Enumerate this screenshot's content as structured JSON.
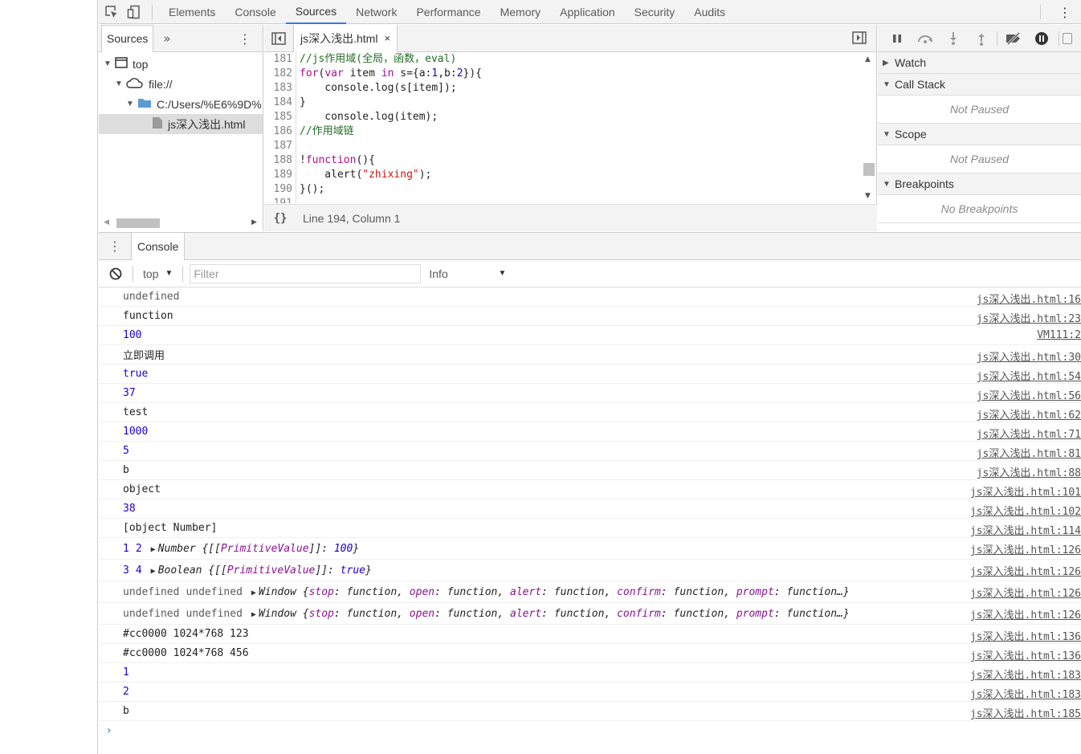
{
  "main_tabs": [
    "Elements",
    "Console",
    "Sources",
    "Network",
    "Performance",
    "Memory",
    "Application",
    "Security",
    "Audits"
  ],
  "active_main_tab": "Sources",
  "navigator": {
    "tab_label": "Sources",
    "more": "»",
    "tree": [
      {
        "label": "top",
        "level": 0,
        "icon": "frame-icon"
      },
      {
        "label": "file://",
        "level": 1,
        "icon": "cloud-icon"
      },
      {
        "label": "C:/Users/%E6%9D%",
        "level": 2,
        "icon": "folder-icon"
      },
      {
        "label": "js深入浅出.html",
        "level": 3,
        "icon": "file-icon",
        "selected": true
      }
    ]
  },
  "editor": {
    "file_tab": "js深入浅出.html",
    "close": "×",
    "status": "Line 194, Column 1",
    "pretty_print": "{}",
    "lines": [
      {
        "n": "181",
        "html": "<span class='cm'>//js作用域(全局，函数，eval)</span>"
      },
      {
        "n": "182",
        "html": "<span class='kw'>for</span>(<span class='kw'>var</span> item <span class='kw'>in</span> s={a:<span class='num'>1</span>,b:<span class='num'>2</span>}){"
      },
      {
        "n": "183",
        "html": "    console.log(s[item]);"
      },
      {
        "n": "184",
        "html": "}"
      },
      {
        "n": "185",
        "html": "    console.log(item);"
      },
      {
        "n": "186",
        "html": "<span class='cm'>//作用域链</span>"
      },
      {
        "n": "187",
        "html": ""
      },
      {
        "n": "188",
        "html": "!<span class='kw'>function</span>(){"
      },
      {
        "n": "189",
        "html": "    alert(<span class='str'>\"zhixing\"</span>);"
      },
      {
        "n": "190",
        "html": "}();"
      },
      {
        "n": "191",
        "html": ""
      }
    ]
  },
  "debugger": {
    "panes": [
      {
        "title": "Watch",
        "expanded": false
      },
      {
        "title": "Call Stack",
        "expanded": true,
        "body": "Not Paused"
      },
      {
        "title": "Scope",
        "expanded": true,
        "body": "Not Paused"
      },
      {
        "title": "Breakpoints",
        "expanded": true,
        "body": "No Breakpoints"
      }
    ]
  },
  "drawer": {
    "tab": "Console",
    "context": "top",
    "filter_placeholder": "Filter",
    "level": "Info",
    "messages": [
      {
        "text": "undefined",
        "cls": "gray",
        "src": "js深入浅出.html:16"
      },
      {
        "text": "function",
        "cls": "",
        "src": "js深入浅出.html:23"
      },
      {
        "text": "100",
        "cls": "num",
        "src": "VM111:2"
      },
      {
        "text": "立即调用",
        "cls": "",
        "src": "js深入浅出.html:30"
      },
      {
        "text": "true",
        "cls": "bool",
        "src": "js深入浅出.html:54"
      },
      {
        "text": "37",
        "cls": "num",
        "src": "js深入浅出.html:56"
      },
      {
        "text": "test",
        "cls": "",
        "src": "js深入浅出.html:62"
      },
      {
        "text": "1000",
        "cls": "num",
        "src": "js深入浅出.html:71"
      },
      {
        "text": "5",
        "cls": "num",
        "src": "js深入浅出.html:81"
      },
      {
        "text": "b",
        "cls": "",
        "src": "js深入浅出.html:88"
      },
      {
        "text": "object",
        "cls": "",
        "src": "js深入浅出.html:101"
      },
      {
        "text": "38",
        "cls": "num",
        "src": "js深入浅出.html:102"
      },
      {
        "text": "[object Number]",
        "cls": "",
        "src": "js深入浅出.html:114"
      },
      {
        "html": "<span class='n'>1</span><span class='n'>2</span><span class='obj'><span class='exp'>▶</span>Number {[[<span class='p'>PrimitiveValue</span>]]: <span class='v'>100</span>}</span>",
        "src": "js深入浅出.html:126",
        "tall": true
      },
      {
        "html": "<span class='n'>3</span><span class='n'>4</span><span class='obj'><span class='exp'>▶</span>Boolean {[[<span class='p'>PrimitiveValue</span>]]: <span class='v'>true</span>}</span>",
        "src": "js深入浅出.html:126",
        "tall": true
      },
      {
        "html": "<span class='u'>undefined</span><span class='u'>undefined</span><span class='obj'><span class='exp'>▶</span>Window {<span class='p'>stop</span>: function, <span class='p'>open</span>: function, <span class='p'>alert</span>: function, <span class='p'>confirm</span>: function, <span class='p'>prompt</span>: function…}</span>",
        "src": "js深入浅出.html:126",
        "tall": true
      },
      {
        "html": "<span class='u'>undefined</span><span class='u'>undefined</span><span class='obj'><span class='exp'>▶</span>Window {<span class='p'>stop</span>: function, <span class='p'>open</span>: function, <span class='p'>alert</span>: function, <span class='p'>confirm</span>: function, <span class='p'>prompt</span>: function…}</span>",
        "src": "js深入浅出.html:126",
        "tall": true
      },
      {
        "text": "#cc0000 1024*768 123",
        "cls": "",
        "src": "js深入浅出.html:136"
      },
      {
        "text": "#cc0000 1024*768 456",
        "cls": "",
        "src": "js深入浅出.html:136"
      },
      {
        "text": "1",
        "cls": "num",
        "src": "js深入浅出.html:183"
      },
      {
        "text": "2",
        "cls": "num",
        "src": "js深入浅出.html:183"
      },
      {
        "text": "b",
        "cls": "",
        "src": "js深入浅出.html:185"
      }
    ],
    "prompt": "›"
  }
}
